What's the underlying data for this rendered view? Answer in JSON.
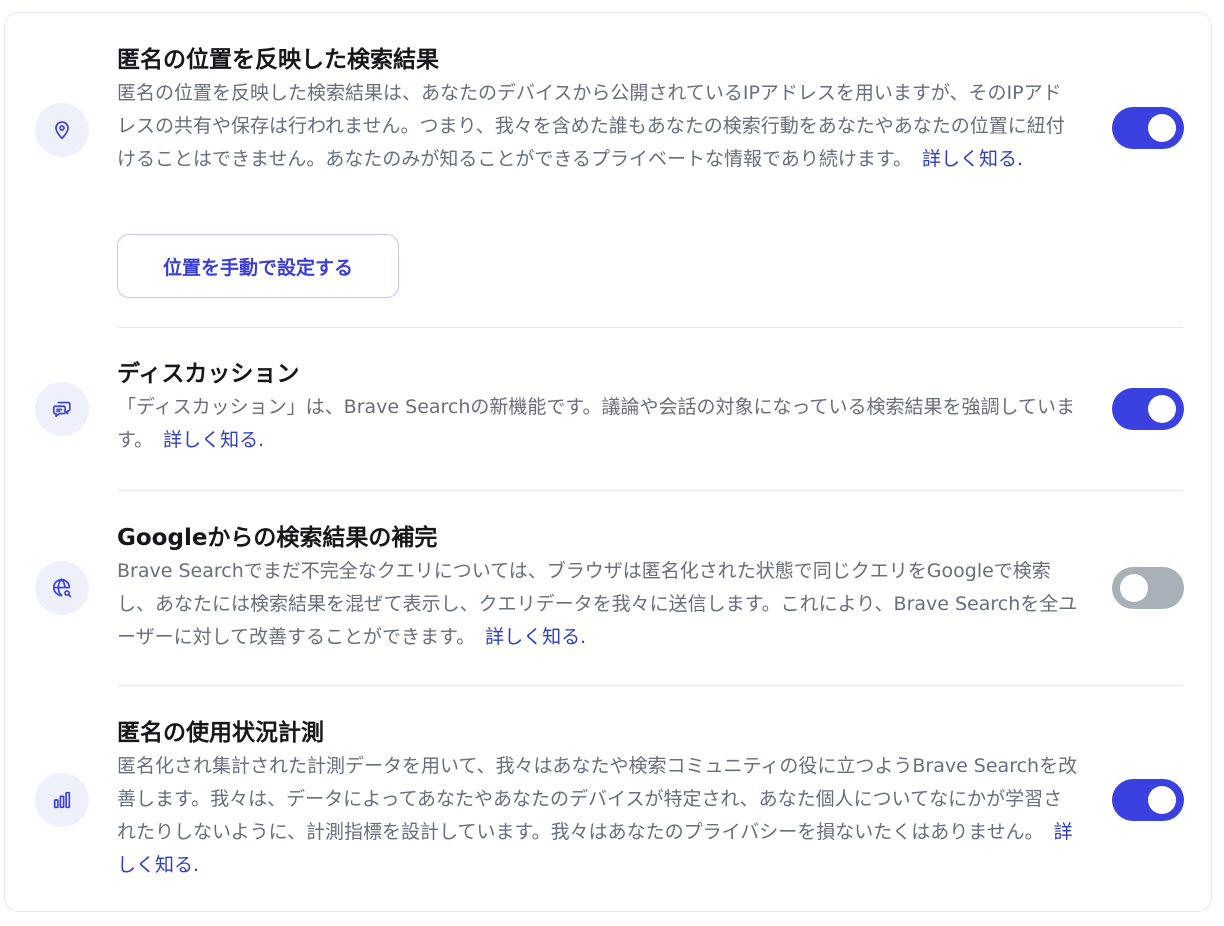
{
  "sections": [
    {
      "icon": "location-pin-icon",
      "title": "匿名の位置を反映した検索結果",
      "description": "匿名の位置を反映した検索結果は、あなたのデバイスから公開されているIPアドレスを用いますが、そのIPアドレスの共有や保存は行われません。つまり、我々を含めた誰もあなたの検索行動をあなたやあなたの位置に紐付けることはできません。あなたのみが知ることができるプライベートな情報であり続けます。",
      "learn_more": "詳しく知る.",
      "enabled": true,
      "button_label": "位置を手動で設定する"
    },
    {
      "icon": "discussion-icon",
      "title": "ディスカッション",
      "description": "「ディスカッション」は、Brave Searchの新機能です。議論や会話の対象になっている検索結果を強調しています。",
      "learn_more": "詳しく知る.",
      "enabled": true
    },
    {
      "icon": "globe-search-icon",
      "title": "Googleからの検索結果の補完",
      "description": "Brave Searchでまだ不完全なクエリについては、ブラウザは匿名化された状態で同じクエリをGoogleで検索し、あなたには検索結果を混ぜて表示し、クエリデータを我々に送信します。これにより、Brave Searchを全ユーザーに対して改善することができます。",
      "learn_more": "詳しく知る.",
      "enabled": false
    },
    {
      "icon": "bar-chart-icon",
      "title": "匿名の使用状況計測",
      "description": "匿名化され集計された計測データを用いて、我々はあなたや検索コミュニティの役に立つようBrave Searchを改善します。我々は、データによってあなたやあなたのデバイスが特定され、あなた個人についてなにかが学習されたりしないように、計測指標を設計しています。我々はあなたのプライバシーを損ないたくはありません。",
      "learn_more": "詳しく知る.",
      "enabled": true
    }
  ],
  "colors": {
    "accent": "#3b40e0",
    "link": "#2d3ec2",
    "toggle_off": "#a8b1b8",
    "icon_bg": "#eef0fb"
  }
}
